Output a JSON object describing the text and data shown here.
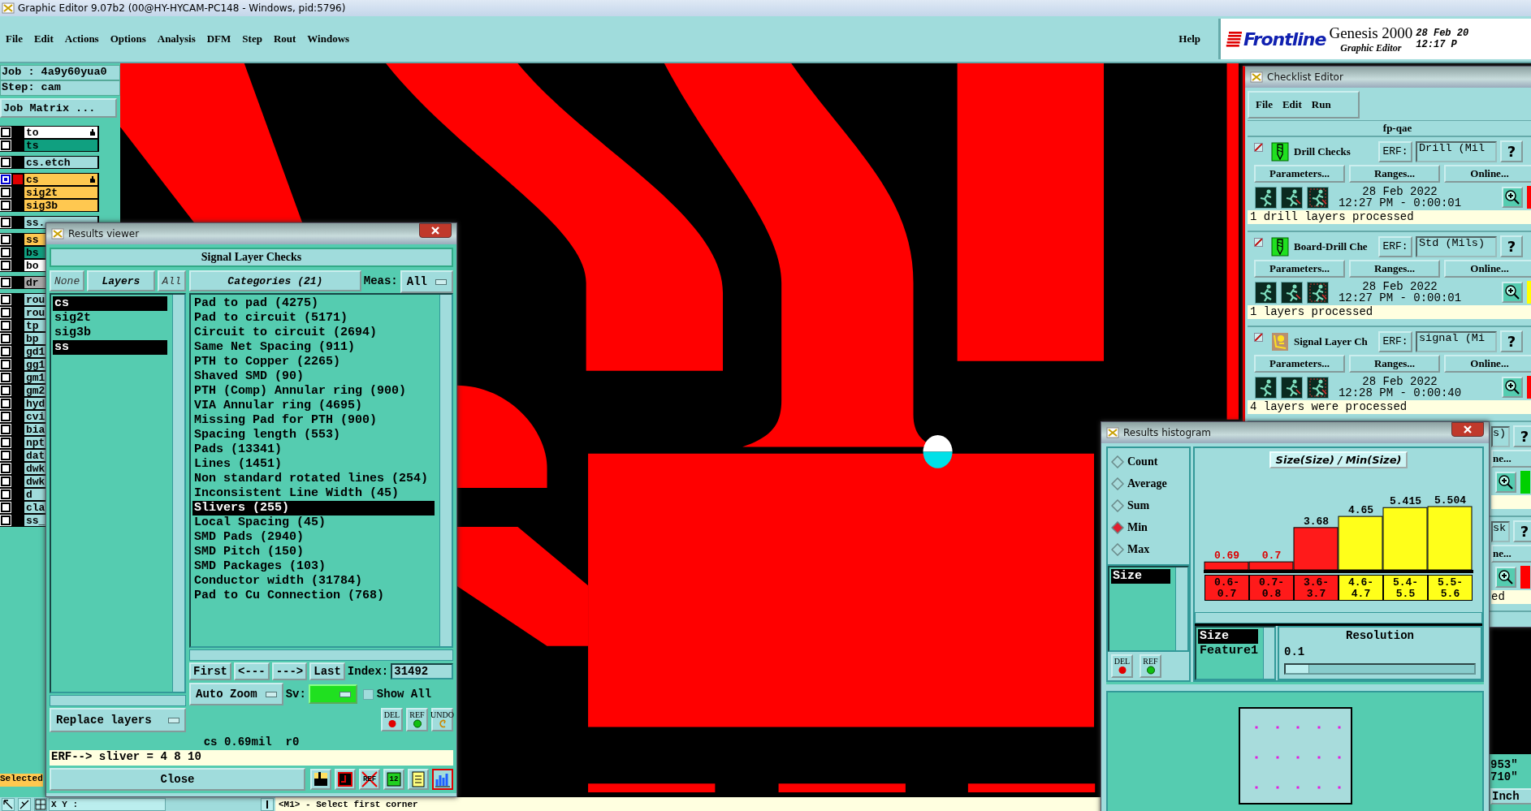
{
  "window": {
    "title": "Graphic Editor 9.07b2 (00@HY-HYCAM-PC148 - Windows, pid:5796)"
  },
  "menu": {
    "items": [
      "File",
      "Edit",
      "Actions",
      "Options",
      "Analysis",
      "DFM",
      "Step",
      "Rout",
      "Windows"
    ],
    "help": "Help"
  },
  "brand": {
    "logo": "Frontline",
    "product": "Genesis 2000",
    "subtitle": "Graphic Editor",
    "date": "28 Feb 20",
    "time": "12:17 P"
  },
  "job_panel": {
    "job": "Job : 4a9y60yua0",
    "step": "Step: cam",
    "matrix_button": "Job Matrix ...",
    "selected_label": "Selected",
    "layer_groups": [
      {
        "layers": [
          {
            "name": "to",
            "color": "#ffffff",
            "selected": false,
            "marked": true
          },
          {
            "name": "ts",
            "color": "#10a080",
            "selected": false,
            "marked": false
          }
        ]
      },
      {
        "layers": [
          {
            "name": "cs.etch",
            "color": "#a0dcdc",
            "selected": false,
            "marked": false
          }
        ]
      },
      {
        "layers": [
          {
            "name": "cs",
            "color": "#ffc850",
            "selected": true,
            "marked": true
          },
          {
            "name": "sig2t",
            "color": "#ffc850",
            "selected": false,
            "marked": false
          },
          {
            "name": "sig3b",
            "color": "#ffc850",
            "selected": false,
            "marked": false
          }
        ]
      },
      {
        "layers": [
          {
            "name": "ss.",
            "color": "#a0dcdc",
            "selected": false,
            "marked": false
          }
        ]
      },
      {
        "layers": [
          {
            "name": "ss",
            "color": "#ffc850",
            "selected": false,
            "marked": false
          },
          {
            "name": "bs",
            "color": "#10a080",
            "selected": false,
            "marked": false
          },
          {
            "name": "bo",
            "color": "#ffffff",
            "selected": false,
            "marked": false
          }
        ]
      },
      {
        "layers": [
          {
            "name": "dr",
            "color": "#a8a8a8",
            "selected": false,
            "marked": false
          }
        ]
      },
      {
        "layers": [
          {
            "name": "rou",
            "color": "#a0dcdc",
            "selected": false,
            "marked": false
          },
          {
            "name": "rou",
            "color": "#a0dcdc",
            "selected": false,
            "marked": false
          },
          {
            "name": "tp",
            "color": "#a0dcdc",
            "selected": false,
            "marked": false
          },
          {
            "name": "bp",
            "color": "#a0dcdc",
            "selected": false,
            "marked": false
          },
          {
            "name": "gd1",
            "color": "#a0dcdc",
            "selected": false,
            "marked": false
          },
          {
            "name": "gg1",
            "color": "#a0dcdc",
            "selected": false,
            "marked": false
          },
          {
            "name": "gm1",
            "color": "#a0dcdc",
            "selected": false,
            "marked": false
          },
          {
            "name": "gm2",
            "color": "#a0dcdc",
            "selected": false,
            "marked": false
          },
          {
            "name": "hyd",
            "color": "#a0dcdc",
            "selected": false,
            "marked": false
          },
          {
            "name": "cvi",
            "color": "#a0dcdc",
            "selected": false,
            "marked": false
          },
          {
            "name": "bia",
            "color": "#a0dcdc",
            "selected": false,
            "marked": false
          },
          {
            "name": "npt",
            "color": "#a0dcdc",
            "selected": false,
            "marked": false
          },
          {
            "name": "dat",
            "color": "#a0dcdc",
            "selected": false,
            "marked": false
          },
          {
            "name": "dwk",
            "color": "#a0dcdc",
            "selected": false,
            "marked": false
          },
          {
            "name": "dwk",
            "color": "#a0dcdc",
            "selected": false,
            "marked": false
          },
          {
            "name": "d",
            "color": "#a0dcdc",
            "selected": false,
            "marked": false
          },
          {
            "name": "cla",
            "color": "#a0dcdc",
            "selected": false,
            "marked": false
          },
          {
            "name": "ss_",
            "color": "#a0dcdc",
            "selected": false,
            "marked": false
          }
        ]
      }
    ]
  },
  "results_viewer": {
    "title": "Results viewer",
    "header": "Signal Layer Checks",
    "none_button": "None",
    "layers_label": "Layers",
    "all_button": "All",
    "layers": [
      {
        "name": "cs",
        "selected": true
      },
      {
        "name": "sig2t",
        "selected": false
      },
      {
        "name": "sig3b",
        "selected": false
      },
      {
        "name": "ss",
        "selected": true
      }
    ],
    "categories_label": "Categories (21)",
    "meas_label": "Meas:",
    "meas_value": "All",
    "categories": [
      {
        "name": "Pad to pad (4275)",
        "selected": false
      },
      {
        "name": "Pad to circuit (5171)",
        "selected": false
      },
      {
        "name": "Circuit to circuit (2694)",
        "selected": false
      },
      {
        "name": "Same Net Spacing (911)",
        "selected": false
      },
      {
        "name": "PTH to Copper (2265)",
        "selected": false
      },
      {
        "name": "Shaved SMD (90)",
        "selected": false
      },
      {
        "name": "PTH (Comp) Annular ring (900)",
        "selected": false
      },
      {
        "name": "VIA Annular ring (4695)",
        "selected": false
      },
      {
        "name": "Missing Pad for PTH (900)",
        "selected": false
      },
      {
        "name": "Spacing length (553)",
        "selected": false
      },
      {
        "name": "Pads (13341)",
        "selected": false
      },
      {
        "name": "Lines (1451)",
        "selected": false
      },
      {
        "name": "Non standard rotated lines (254)",
        "selected": false
      },
      {
        "name": "Inconsistent Line Width (45)",
        "selected": false
      },
      {
        "name": "Slivers (255)",
        "selected": true
      },
      {
        "name": "Local Spacing (45)",
        "selected": false
      },
      {
        "name": "SMD Pads (2940)",
        "selected": false
      },
      {
        "name": "SMD Pitch (150)",
        "selected": false
      },
      {
        "name": "SMD Packages (103)",
        "selected": false
      },
      {
        "name": "Conductor width (31784)",
        "selected": false
      },
      {
        "name": "Pad to Cu Connection (768)",
        "selected": false
      }
    ],
    "nav": [
      "First",
      "<---",
      "--->",
      "Last"
    ],
    "index_label": "Index:",
    "index_value": "31492",
    "zoom_mode": "Auto Zoom",
    "sv_label": "Sv:",
    "show_all": {
      "label": "Show All",
      "checked": false
    },
    "replace_mode": "Replace layers",
    "actions": [
      {
        "kind": "delete",
        "label": "DEL"
      },
      {
        "kind": "ref",
        "label": "REF"
      },
      {
        "kind": "undo",
        "label": "UNDO"
      }
    ],
    "measure": "cs 0.69mil  r0",
    "erf": "ERF--> sliver = 4 8 10",
    "close": "Close",
    "toolbar": [
      {
        "kind": "figure",
        "selected": false
      },
      {
        "kind": "report",
        "selected": false
      },
      {
        "kind": "noref",
        "label": "REF",
        "selected": false
      },
      {
        "kind": "number",
        "label": "12",
        "selected": false
      },
      {
        "kind": "notes",
        "selected": false
      },
      {
        "kind": "histogram",
        "selected": true
      }
    ]
  },
  "checklist_editor": {
    "title": "Checklist Editor",
    "menu": [
      "File",
      "Edit",
      "Run"
    ],
    "name": "fp-qae",
    "checks": [
      {
        "kind": "full",
        "checked": true,
        "name": "Drill Checks",
        "erf_label": "ERF:",
        "erf_value": "Drill (Mil",
        "help": "?",
        "buttons": [
          "Parameters...",
          "Ranges...",
          "Online..."
        ],
        "date": "28 Feb 2022",
        "time": "12:27 PM - 0:00:01",
        "status": "1 drill layers processed",
        "color": "#ff0000"
      },
      {
        "kind": "full",
        "checked": true,
        "name": "Board-Drill Che",
        "erf_label": "ERF:",
        "erf_value": "Std (Mils)",
        "help": "?",
        "buttons": [
          "Parameters...",
          "Ranges...",
          "Online..."
        ],
        "date": "28 Feb 2022",
        "time": "12:27 PM - 0:00:01",
        "status": "1 layers processed",
        "color": "#ffff00"
      },
      {
        "kind": "full",
        "checked": true,
        "name": "Signal Layer Ch",
        "erf_label": "ERF:",
        "erf_value": "signal (Mi",
        "help": "?",
        "buttons": [
          "Parameters...",
          "Ranges...",
          "Online..."
        ],
        "date": "28 Feb 2022",
        "time": "12:28 PM - 0:00:40",
        "status": "4 layers were processed",
        "color": "#ff0000"
      },
      {
        "kind": "partial",
        "erf_value": "s)",
        "help": "?",
        "online": "ne...",
        "color": "#00d000"
      },
      {
        "kind": "partial",
        "erf_value": "sk",
        "help": "?",
        "online": "ne...",
        "status": "ed",
        "color": "#ff0000"
      }
    ]
  },
  "histogram": {
    "title": "Results histogram",
    "modes": [
      {
        "label": "Count",
        "selected": false
      },
      {
        "label": "Average",
        "selected": false
      },
      {
        "label": "Sum",
        "selected": false
      },
      {
        "label": "Min",
        "selected": true
      },
      {
        "label": "Max",
        "selected": false
      }
    ],
    "fields": [
      {
        "name": "Size",
        "selected": true
      }
    ],
    "actions": [
      {
        "kind": "delete",
        "label": "DEL"
      },
      {
        "kind": "ref",
        "label": "REF"
      }
    ],
    "chart_data": {
      "type": "bar",
      "title": "Size(Size) / Min(Size)",
      "categories": [
        "0.6-0.7",
        "0.7-0.8",
        "3.6-3.7",
        "4.6-4.7",
        "5.4-5.5",
        "5.5-5.6"
      ],
      "series": [
        {
          "color": "#ff1a1a",
          "values": [
            0.69,
            0.7,
            3.68,
            null,
            null,
            null
          ]
        },
        {
          "color": "#ffff1a",
          "values": [
            null,
            null,
            null,
            4.65,
            5.415,
            5.504
          ]
        }
      ],
      "data_labels": true
    },
    "features": [
      {
        "name": "Size",
        "selected": true
      },
      {
        "name": "Feature1",
        "selected": false
      }
    ],
    "resolution_label": "Resolution",
    "resolution_value": "0.1",
    "resolution": {
      "level": 0
    }
  },
  "coordinates": {
    "x": "953\"",
    "y": "710\"",
    "units": "Inch"
  },
  "status_bar": {
    "xy_label": "X Y :",
    "prompt": "<M1> - Select first corner"
  }
}
